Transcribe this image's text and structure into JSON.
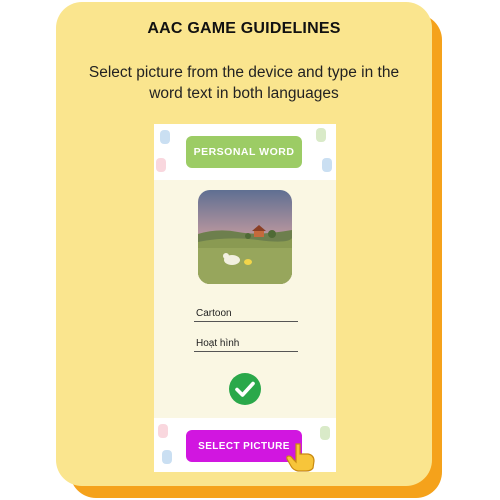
{
  "title": "AAC GAME GUIDELINES",
  "description": "Select picture from the device and type in the word text in both languages",
  "phone": {
    "personal_word_label": "PERSONAL WORD",
    "word_english": "Cartoon",
    "word_vietnamese": "Hoạt hình",
    "select_picture_label": "SELECT PICTURE",
    "confirm_icon": "check-circle-icon",
    "pointer_icon": "pointing-hand-icon"
  },
  "colors": {
    "card": "#fae58e",
    "card_shadow": "#f5a21b",
    "personal_word_button": "#9ccc65",
    "select_picture_button": "#d116e0",
    "check": "#2aa84a"
  }
}
